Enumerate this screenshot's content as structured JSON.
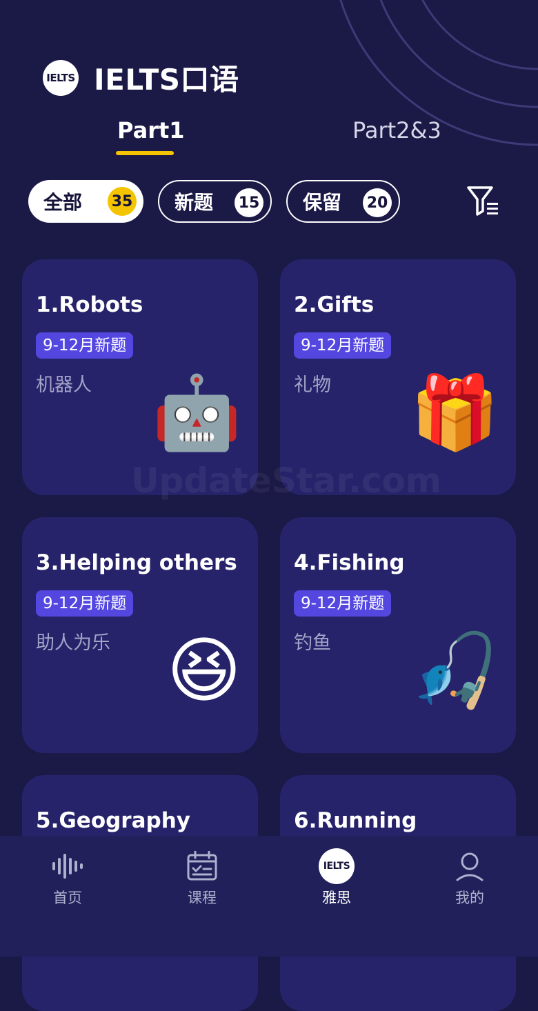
{
  "app": {
    "logo_text": "IELTS",
    "title": "IELTS口语"
  },
  "tabs": [
    {
      "label": "Part1",
      "active": true
    },
    {
      "label": "Part2&3",
      "active": false
    }
  ],
  "filters": [
    {
      "label": "全部",
      "count": "35",
      "active": true
    },
    {
      "label": "新题",
      "count": "15",
      "active": false
    },
    {
      "label": "保留",
      "count": "20",
      "active": false
    }
  ],
  "filter_icon": "filter-list-icon",
  "topics": [
    {
      "title": "1.Robots",
      "badge": "9-12月新题",
      "subtitle": "机器人",
      "emoji": "🤖",
      "icon": "robot-icon"
    },
    {
      "title": "2.Gifts",
      "badge": "9-12月新题",
      "subtitle": "礼物",
      "emoji": "🎁",
      "icon": "gift-icon"
    },
    {
      "title": "3.Helping others",
      "badge": "9-12月新题",
      "subtitle": "助人为乐",
      "emoji": "😆",
      "icon": "laughing-face-icon"
    },
    {
      "title": "4.Fishing",
      "badge": "9-12月新题",
      "subtitle": "钓鱼",
      "emoji": "🎣",
      "icon": "fishing-pole-icon"
    },
    {
      "title": "5.Geography"
    },
    {
      "title": "6.Running"
    }
  ],
  "watermark": "UpdateStar.com",
  "bottom_nav": [
    {
      "label": "首页",
      "icon": "waveform-icon",
      "active": false
    },
    {
      "label": "课程",
      "icon": "calendar-check-icon",
      "active": false
    },
    {
      "label": "雅思",
      "icon": "ielts-logo-icon",
      "logo_text": "IELTS",
      "active": true
    },
    {
      "label": "我的",
      "icon": "profile-icon",
      "active": false
    }
  ],
  "colors": {
    "background": "#1b1946",
    "card": "#26236a",
    "accent": "#f5c400",
    "badge": "#5447e0",
    "nav": "#21205a"
  }
}
